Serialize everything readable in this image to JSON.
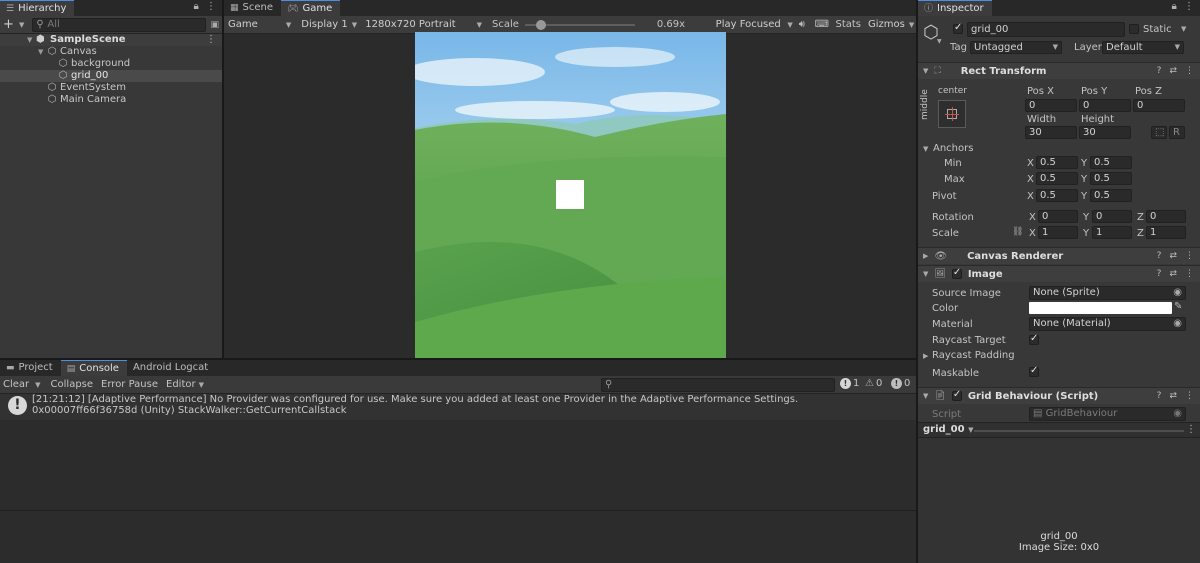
{
  "hierarchy": {
    "tab_label": "Hierarchy",
    "add_label": "+",
    "search_placeholder": "All",
    "items": [
      {
        "label": "SampleScene"
      },
      {
        "label": "Canvas"
      },
      {
        "label": "background"
      },
      {
        "label": "grid_00"
      },
      {
        "label": "EventSystem"
      },
      {
        "label": "Main Camera"
      }
    ]
  },
  "center": {
    "tabs": [
      {
        "label": "Scene"
      },
      {
        "label": "Game"
      }
    ],
    "toolbar": {
      "mode": "Game",
      "display": "Display 1",
      "resolution": "1280x720 Portrait",
      "scale_label": "Scale",
      "scale_value": "0.69x",
      "scale_fraction": 0.15,
      "play_mode": "Play Focused",
      "stats": "Stats",
      "gizmos": "Gizmos"
    }
  },
  "bottom": {
    "tabs": [
      {
        "label": "Project"
      },
      {
        "label": "Console"
      },
      {
        "label": "Android Logcat"
      }
    ],
    "toolbar": {
      "clear": "Clear",
      "collapse": "Collapse",
      "error_pause": "Error Pause",
      "editor": "Editor",
      "count_errors": "1",
      "count_warnings": "0",
      "count_infos": "0"
    },
    "messages": [
      {
        "line1": "[21:21:12] [Adaptive Performance] No Provider was configured for use. Make sure you added at least one Provider in the Adaptive Performance Settings.",
        "line2": "0x00007ff66f36758d (Unity) StackWalker::GetCurrentCallstack"
      }
    ]
  },
  "inspector": {
    "tab_label": "Inspector",
    "object_name": "grid_00",
    "static_label": "Static",
    "tag_label": "Tag",
    "tag_value": "Untagged",
    "layer_label": "Layer",
    "layer_value": "Default",
    "rect_transform": {
      "title": "Rect Transform",
      "anchor_h": "center",
      "anchor_v": "middle",
      "pos_x_label": "Pos X",
      "pos_x": "0",
      "pos_y_label": "Pos Y",
      "pos_y": "0",
      "pos_z_label": "Pos Z",
      "pos_z": "0",
      "width_label": "Width",
      "width": "30",
      "height_label": "Height",
      "height": "30",
      "r_label": "R",
      "anchors_label": "Anchors",
      "min_label": "Min",
      "min_x": "0.5",
      "min_y": "0.5",
      "max_label": "Max",
      "max_x": "0.5",
      "max_y": "0.5",
      "pivot_label": "Pivot",
      "pivot_x": "0.5",
      "pivot_y": "0.5",
      "rotation_label": "Rotation",
      "rot_x": "0",
      "rot_y": "0",
      "rot_z": "0",
      "scale_label": "Scale",
      "scale_x": "1",
      "scale_y": "1",
      "scale_z": "1",
      "x": "X",
      "y": "Y",
      "z": "Z"
    },
    "canvas_renderer": {
      "title": "Canvas Renderer"
    },
    "image": {
      "title": "Image",
      "source_image_label": "Source Image",
      "source_image": "None (Sprite)",
      "color_label": "Color",
      "color_value": "#ffffff",
      "material_label": "Material",
      "material": "None (Material)",
      "raycast_target_label": "Raycast Target",
      "raycast_padding_label": "Raycast Padding",
      "maskable_label": "Maskable"
    },
    "grid_behaviour": {
      "title": "Grid Behaviour (Script)",
      "script_label": "Script",
      "script_value": "GridBehaviour"
    },
    "preview": {
      "selector": "grid_00",
      "name": "grid_00",
      "size": "Image Size: 0x0"
    }
  },
  "colors": {
    "accent": "#4a8ee6",
    "panel": "#383838",
    "sky_top": "#8fc3ea",
    "grass": "#5aa84a"
  }
}
